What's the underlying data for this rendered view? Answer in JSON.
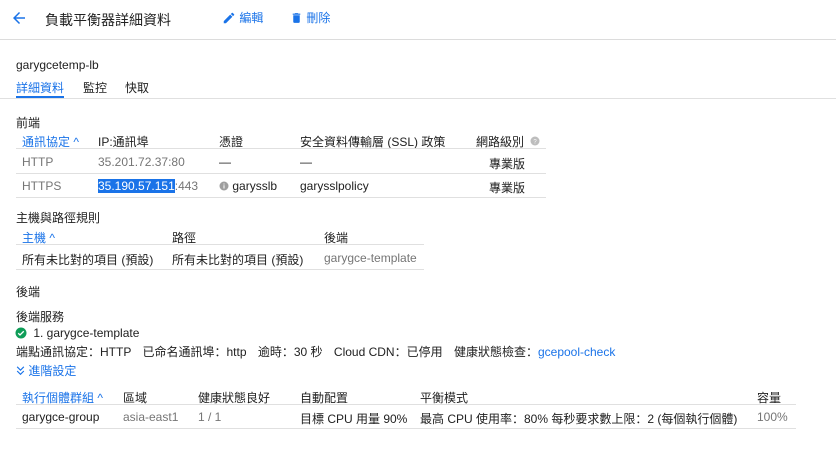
{
  "header": {
    "title": "負載平衡器詳細資料",
    "edit_label": "編輯",
    "delete_label": "刪除"
  },
  "lb_name": "garygcetemp-lb",
  "tabs": [
    {
      "label": "詳細資料",
      "active": true
    },
    {
      "label": "監控",
      "active": false
    },
    {
      "label": "快取",
      "active": false
    }
  ],
  "frontend": {
    "title": "前端",
    "columns": [
      "通訊協定",
      "IP:通訊埠",
      "憑證",
      "安全資料傳輸層 (SSL) 政策",
      "網路級別"
    ],
    "rows": [
      {
        "protocol": "HTTP",
        "ip_port": "35.201.72.37:80",
        "cert": "—",
        "ssl_policy": "—",
        "tier": "專業版"
      },
      {
        "protocol": "HTTPS",
        "ip_selected": "35.190.57.151",
        "port_suffix": ":443",
        "cert": "garysslb",
        "ssl_policy": "garysslpolicy",
        "tier": "專業版"
      }
    ]
  },
  "host_rules": {
    "title": "主機與路徑規則",
    "columns": [
      "主機",
      "路徑",
      "後端"
    ],
    "row": {
      "host": "所有未比對的項目 (預設)",
      "path": "所有未比對的項目 (預設)",
      "backend": "garygce-template"
    }
  },
  "backend": {
    "title": "後端",
    "services_title": "後端服務",
    "service_name": "1. garygce-template",
    "props": {
      "endpoint_protocol_label": "端點通訊協定：",
      "endpoint_protocol": "HTTP",
      "named_port_label": "已命名通訊埠：",
      "named_port": "http",
      "timeout_label": "逾時：",
      "timeout": "30 秒",
      "cdn_label": "Cloud CDN：",
      "cdn": "已停用",
      "health_label": "健康狀態檢查：",
      "health_check": "gcepool-check"
    },
    "advanced_label": "進階設定",
    "columns": [
      "執行個體群組",
      "區域",
      "健康狀態良好",
      "自動配置",
      "平衡模式",
      "容量"
    ],
    "row": {
      "group": "garygce-group",
      "region": "asia-east1",
      "healthy": "1 / 1",
      "autoscale": "目標 CPU 用量 90%",
      "balance": "最高 CPU 使用率：80% 每秒要求數上限：2 (每個執行個體)",
      "capacity": "100%"
    }
  },
  "colors": {
    "accent": "#1a73e8",
    "success": "#0f9d58"
  }
}
